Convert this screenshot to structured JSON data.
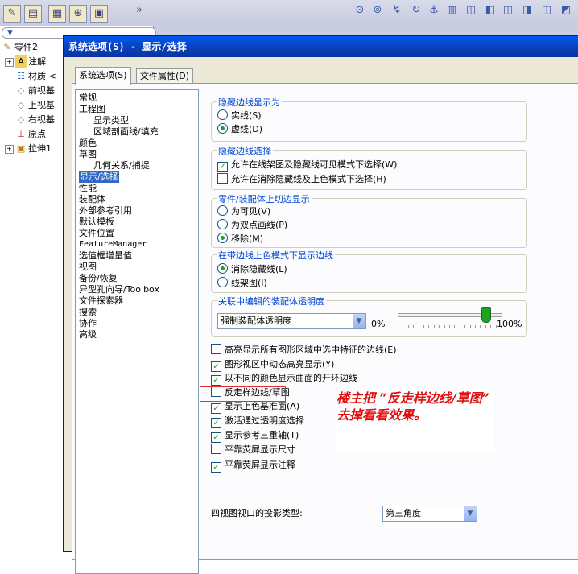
{
  "dialog": {
    "title": "系统选项(S) - 显示/选择",
    "tabs": [
      {
        "label": "系统选项(S)",
        "active": true
      },
      {
        "label": "文件属性(D)",
        "active": false
      }
    ]
  },
  "feature_tree": {
    "items": [
      "零件2",
      "注解",
      "材质 <",
      "前视基",
      "上视基",
      "右视基",
      "原点",
      "拉伸1"
    ]
  },
  "options_tree": [
    {
      "label": "常规",
      "indent": 0
    },
    {
      "label": "工程图",
      "indent": 0
    },
    {
      "label": "显示类型",
      "indent": 2
    },
    {
      "label": "区域剖面线/填充",
      "indent": 2
    },
    {
      "label": "颜色",
      "indent": 0
    },
    {
      "label": "草图",
      "indent": 0
    },
    {
      "label": "几何关系/捕捉",
      "indent": 2
    },
    {
      "label": "显示/选择",
      "indent": 0,
      "selected": true
    },
    {
      "label": "性能",
      "indent": 0
    },
    {
      "label": "装配体",
      "indent": 0
    },
    {
      "label": "外部参考引用",
      "indent": 0
    },
    {
      "label": "默认模板",
      "indent": 0
    },
    {
      "label": "文件位置",
      "indent": 0
    },
    {
      "label": "FeatureManager",
      "indent": 0,
      "mono": true
    },
    {
      "label": "选值框增量值",
      "indent": 0
    },
    {
      "label": "视图",
      "indent": 0
    },
    {
      "label": "备份/恢复",
      "indent": 0
    },
    {
      "label": "异型孔向导/Toolbox",
      "indent": 0
    },
    {
      "label": "文件探索器",
      "indent": 0
    },
    {
      "label": "搜索",
      "indent": 0
    },
    {
      "label": "协作",
      "indent": 0
    },
    {
      "label": "高级",
      "indent": 0
    }
  ],
  "groups": {
    "hidden_edges_display": {
      "title": "隐藏边线显示为",
      "options": [
        {
          "label": "实线(S)",
          "checked": false
        },
        {
          "label": "虚线(D)",
          "checked": true
        }
      ]
    },
    "hidden_edges_select": {
      "title": "隐藏边线选择",
      "options": [
        {
          "label": "允许在线架图及隐藏线可见模式下选择(W)",
          "checked": true
        },
        {
          "label": "允许在消除隐藏线及上色模式下选择(H)",
          "checked": false
        }
      ]
    },
    "tangent_edges": {
      "title": "零件/装配体上切边显示",
      "options": [
        {
          "label": "为可见(V)",
          "checked": false
        },
        {
          "label": "为双点画线(P)",
          "checked": false
        },
        {
          "label": "移除(M)",
          "checked": true
        }
      ]
    },
    "shaded_edges": {
      "title": "在带边线上色模式下显示边线",
      "options": [
        {
          "label": "消除隐藏线(L)",
          "checked": true
        },
        {
          "label": "线架图(I)",
          "checked": false
        }
      ]
    },
    "transparency": {
      "title": "关联中编辑的装配体透明度",
      "select_value": "强制装配体透明度",
      "min_label": "0%",
      "max_label": "100%",
      "slider_value_percent": 85
    }
  },
  "checkboxes": [
    {
      "label": "高亮显示所有图形区域中选中特征的边线(E)",
      "checked": false
    },
    {
      "label": "图形视区中动态高亮显示(Y)",
      "checked": true
    },
    {
      "label": "以不同的颜色显示曲面的开环边线",
      "checked": true
    },
    {
      "label": "反走样边线/草图",
      "checked": false
    },
    {
      "label": "显示上色基准面(A)",
      "checked": true
    },
    {
      "label": "激活通过透明度选择",
      "checked": true
    },
    {
      "label": "显示参考三重轴(T)",
      "checked": true
    },
    {
      "label": "平靠荧屏显示尺寸",
      "checked": false
    },
    {
      "label": "平靠荧屏显示注释",
      "checked": true
    }
  ],
  "projection": {
    "label": "四视图视口的投影类型:",
    "value": "第三角度"
  },
  "annotation": {
    "text": "楼主把 “反走样边线/草图” 去掉看看效果。"
  },
  "colors": {
    "title_bar": "#0b3fb8",
    "group_title": "#0046d5",
    "check_green": "#21a121",
    "annotation_red": "#e01010",
    "selection_blue": "#316ac5"
  }
}
